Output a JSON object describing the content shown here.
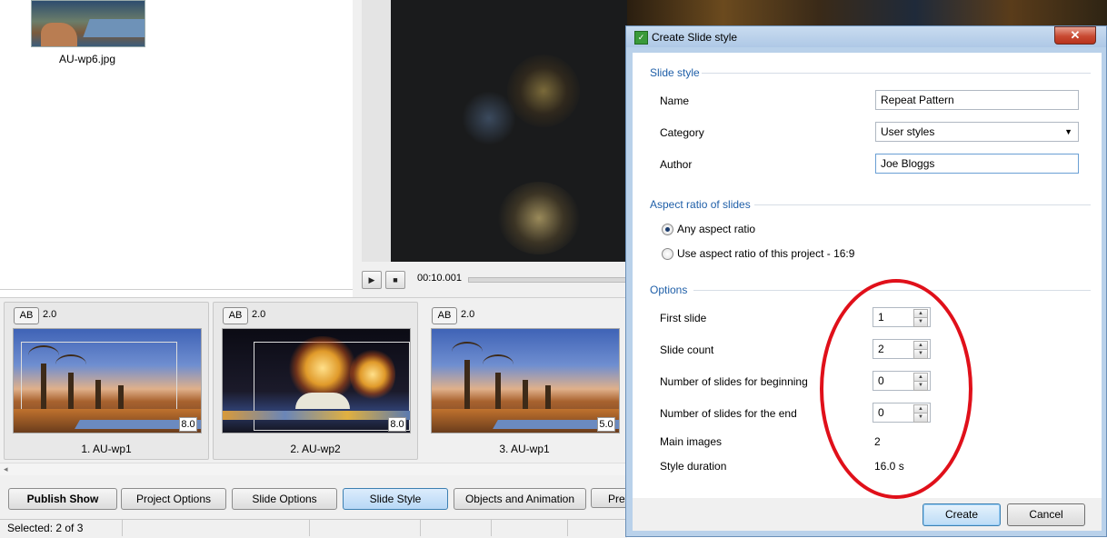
{
  "file_browser": {
    "file_name": "AU-wp6.jpg"
  },
  "preview": {
    "time": "00:10.001",
    "play_icon": "play-icon",
    "stop_icon": "stop-icon"
  },
  "slides": [
    {
      "ab": "AB",
      "transition": "2.0",
      "duration": "8.0",
      "caption": "1. AU-wp1"
    },
    {
      "ab": "AB",
      "transition": "2.0",
      "duration": "8.0",
      "caption": "2. AU-wp2"
    },
    {
      "ab": "AB",
      "transition": "2.0",
      "duration": "5.0",
      "caption": "3. AU-wp1"
    }
  ],
  "toolbar": {
    "publish": "Publish Show",
    "project_options": "Project Options",
    "slide_options": "Slide Options",
    "slide_style": "Slide Style",
    "objects_animation": "Objects and Animation",
    "preview_partial": "Pre"
  },
  "status": {
    "text": "Selected: 2 of 3"
  },
  "dialog": {
    "title": "Create Slide style",
    "close": "✕",
    "slide_style_group": "Slide style",
    "name_label": "Name",
    "name_value": "Repeat Pattern",
    "category_label": "Category",
    "category_value": "User styles",
    "author_label": "Author",
    "author_value": "Joe Bloggs",
    "aspect_group": "Aspect ratio of slides",
    "aspect_any": "Any aspect ratio",
    "aspect_project": "Use aspect ratio of this project - 16:9",
    "options_group": "Options",
    "first_slide_label": "First slide",
    "first_slide_value": "1",
    "slide_count_label": "Slide count",
    "slide_count_value": "2",
    "beginning_label": "Number of slides for beginning",
    "beginning_value": "0",
    "end_label": "Number of slides for the end",
    "end_value": "0",
    "main_images_label": "Main images",
    "main_images_value": "2",
    "style_duration_label": "Style duration",
    "style_duration_value": "16.0 s",
    "create_button": "Create",
    "cancel_button": "Cancel"
  },
  "colors": {
    "annotation": "#e0101a",
    "accent": "#1f5fa8",
    "active_button": "#b8d8f6"
  }
}
